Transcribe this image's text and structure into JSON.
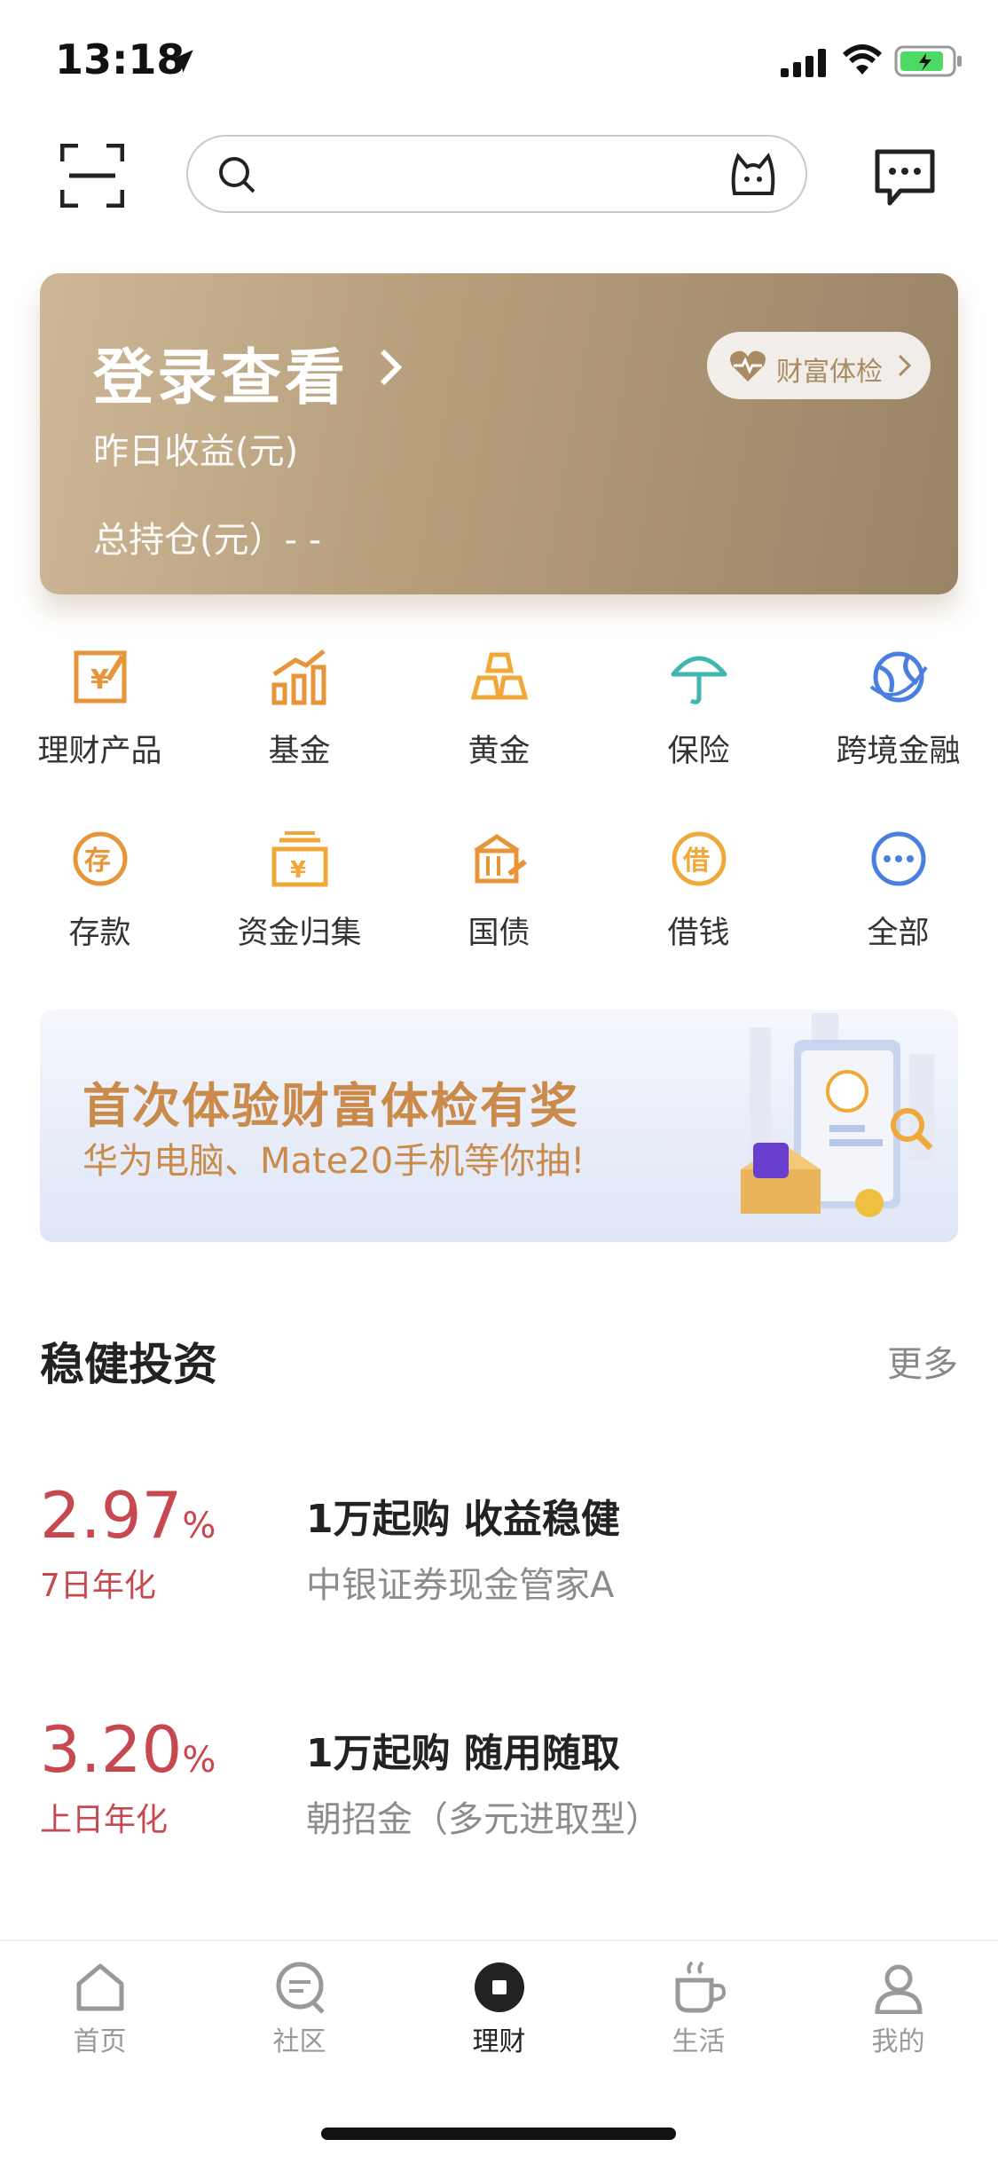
{
  "status_bar": {
    "time": "13:18"
  },
  "search": {
    "placeholder": ""
  },
  "account_card": {
    "login_label": "登录查看",
    "yesterday_label": "昨日收益(元)",
    "total_label": "总持仓(元）- -",
    "checkup_label": "财富体检"
  },
  "grid": [
    {
      "label": "理财产品",
      "icon": "wealth-product-icon"
    },
    {
      "label": "基金",
      "icon": "fund-icon"
    },
    {
      "label": "黄金",
      "icon": "gold-icon"
    },
    {
      "label": "保险",
      "icon": "insurance-icon"
    },
    {
      "label": "跨境金融",
      "icon": "cross-border-icon"
    },
    {
      "label": "存款",
      "icon": "deposit-icon"
    },
    {
      "label": "资金归集",
      "icon": "fund-pool-icon"
    },
    {
      "label": "国债",
      "icon": "bond-icon"
    },
    {
      "label": "借钱",
      "icon": "borrow-icon"
    },
    {
      "label": "全部",
      "icon": "more-icon"
    }
  ],
  "banner": {
    "title": "首次体验财富体检有奖",
    "subtitle": "华为电脑、Mate20手机等你抽!"
  },
  "section": {
    "title": "稳健投资",
    "more": "更多"
  },
  "products": [
    {
      "rate": "2.97",
      "unit": "%",
      "rate_type": "7日年化",
      "title": "1万起购 收益稳健",
      "name": "中银证券现金管家A"
    },
    {
      "rate": "3.20",
      "unit": "%",
      "rate_type": "上日年化",
      "title": "1万起购 随用随取",
      "name": "朝招金（多元进取型）"
    }
  ],
  "tabbar": [
    {
      "label": "首页",
      "icon": "home-icon"
    },
    {
      "label": "社区",
      "icon": "community-icon"
    },
    {
      "label": "理财",
      "icon": "wealth-icon"
    },
    {
      "label": "生活",
      "icon": "life-icon"
    },
    {
      "label": "我的",
      "icon": "profile-icon"
    }
  ],
  "colors": {
    "accent_gold": "#b59d7a",
    "rate_red": "#c8484f",
    "icon_orange": "#e8953a"
  }
}
